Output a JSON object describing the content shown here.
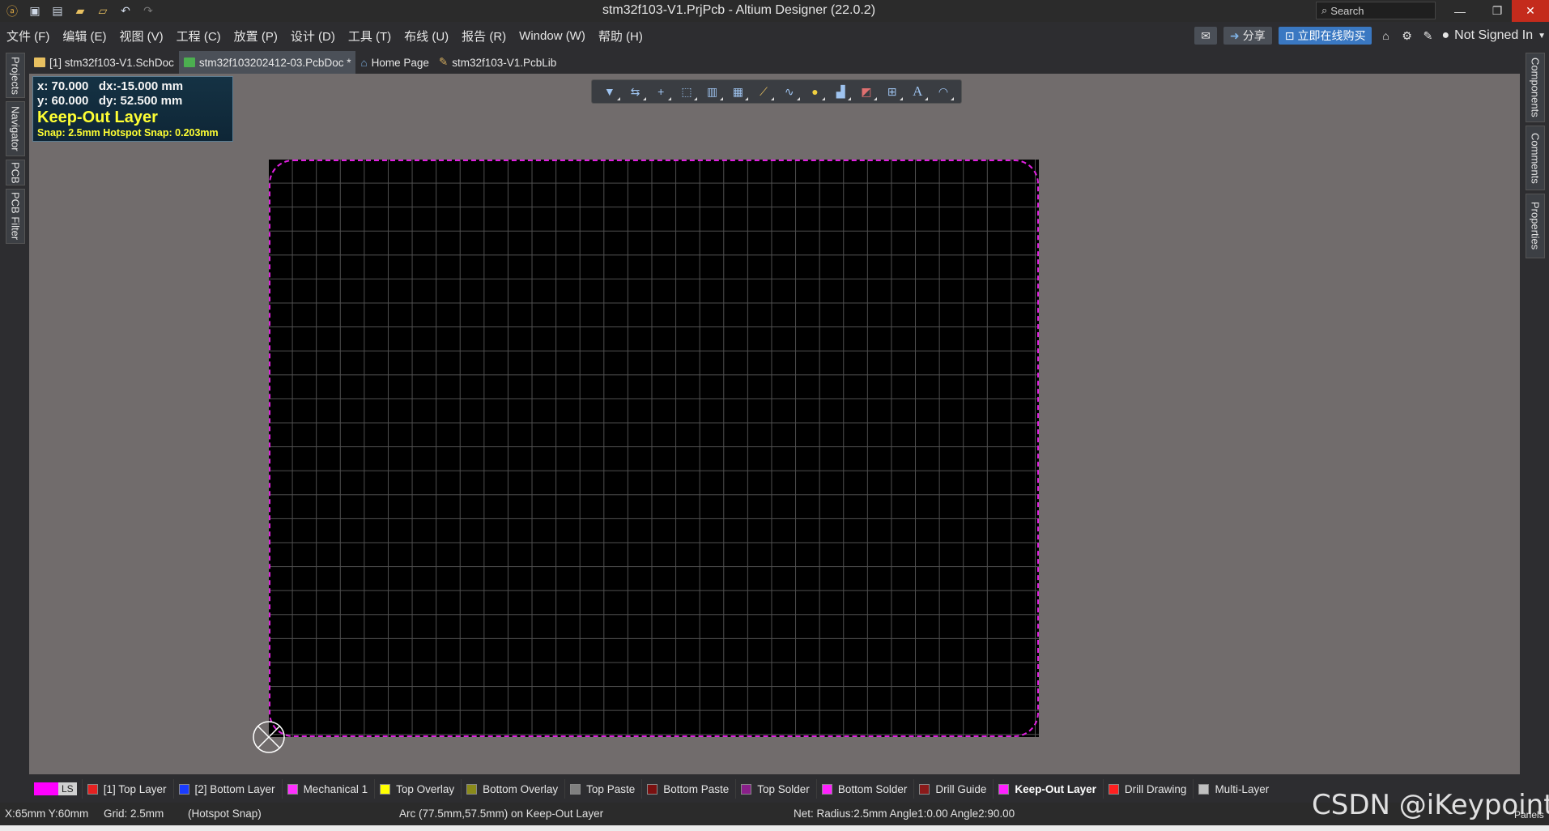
{
  "titlebar": {
    "title": "stm32f103-V1.PrjPcb - Altium Designer (22.0.2)",
    "search_placeholder": "Search",
    "icons": [
      "app-logo-icon",
      "save-icon",
      "save-all-icon",
      "open-icon",
      "open-project-icon",
      "undo-icon",
      "redo-icon"
    ]
  },
  "menu": {
    "items": [
      "文件 (F)",
      "编辑 (E)",
      "视图 (V)",
      "工程 (C)",
      "放置 (P)",
      "设计 (D)",
      "工具 (T)",
      "布线 (U)",
      "报告 (R)",
      "Window (W)",
      "帮助 (H)"
    ],
    "share_label": "分享",
    "buy_label": "立即在线购买",
    "signed_in_label": "Not Signed In"
  },
  "left_panels": [
    "Projects",
    "Navigator",
    "PCB",
    "PCB Filter"
  ],
  "right_panels": [
    "Components",
    "Comments",
    "Properties"
  ],
  "doc_tabs": [
    {
      "label": "[1] stm32f103-V1.SchDoc",
      "color": "#e8c060"
    },
    {
      "label": "stm32f103202412-03.PcbDoc *",
      "color": "#4caf50",
      "active": true
    },
    {
      "label": "Home Page",
      "color": "#7fb2e5"
    },
    {
      "label": "stm32f103-V1.PcbLib",
      "color": "#d8b060"
    }
  ],
  "hud": {
    "line1": "x: 70.000   dx:-15.000 mm",
    "line2": "y: 60.000   dy: 52.500 mm",
    "layer": "Keep-Out Layer",
    "snap": "Snap: 2.5mm Hotspot Snap: 0.203mm"
  },
  "toolbar_tools": [
    "filter-icon",
    "interactive-route-icon",
    "add-icon",
    "select-rect-icon",
    "align-icon",
    "component-icon",
    "route-icon",
    "diff-pair-icon",
    "pad-icon",
    "polygon-icon",
    "region-icon",
    "dimension-icon",
    "text-icon",
    "arc-icon"
  ],
  "layers": {
    "ls_label": "LS",
    "ls_color": "#ff00ff",
    "tabs": [
      {
        "label": "[1] Top Layer",
        "color": "#e52121"
      },
      {
        "label": "[2] Bottom Layer",
        "color": "#1a3cff"
      },
      {
        "label": "Mechanical 1",
        "color": "#ff30ff"
      },
      {
        "label": "Top Overlay",
        "color": "#ffff00"
      },
      {
        "label": "Bottom Overlay",
        "color": "#8a8a1a"
      },
      {
        "label": "Top Paste",
        "color": "#808080"
      },
      {
        "label": "Bottom Paste",
        "color": "#7a1010"
      },
      {
        "label": "Top Solder",
        "color": "#8a1f8a"
      },
      {
        "label": "Bottom Solder",
        "color": "#ff20ff"
      },
      {
        "label": "Drill Guide",
        "color": "#8a1a1a"
      },
      {
        "label": "Keep-Out Layer",
        "color": "#ff20ff",
        "active": true
      },
      {
        "label": "Drill Drawing",
        "color": "#ff2020"
      },
      {
        "label": "Multi-Layer",
        "color": "#c0c0c0"
      }
    ]
  },
  "status": {
    "coords": "X:65mm Y:60mm",
    "grid": "Grid: 2.5mm",
    "snap": "(Hotspot Snap)",
    "object": "Arc (77.5mm,57.5mm) on Keep-Out Layer",
    "net": "Net:  Radius:2.5mm Angle1:0.00 Angle2:90.00",
    "panels": "Panels"
  },
  "watermark": "CSDN @iKeypoint"
}
